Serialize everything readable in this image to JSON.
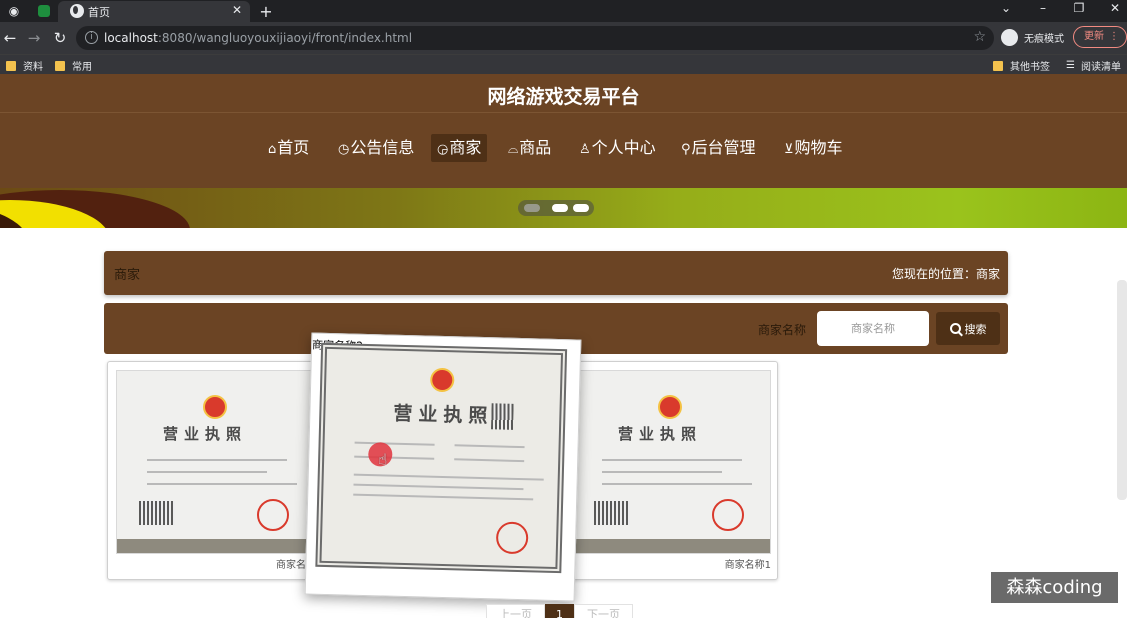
{
  "browser": {
    "tab_title": "首页",
    "url_host": "localhost",
    "url_path": ":8080/wangluoyouxijiaoyi/front/index.html",
    "incognito_label": "无痕模式",
    "update_label": "更新",
    "bookmarks": [
      "资料",
      "常用"
    ],
    "bookmarks_right": [
      "其他书签",
      "阅读清单"
    ]
  },
  "site": {
    "title": "网络游戏交易平台",
    "nav": [
      {
        "icon": "⌂",
        "label": "首页"
      },
      {
        "icon": "◷",
        "label": "公告信息"
      },
      {
        "icon": "◶",
        "label": "商家"
      },
      {
        "icon": "⌓",
        "label": "商品"
      },
      {
        "icon": "♙",
        "label": "个人中心"
      },
      {
        "icon": "⚲",
        "label": "后台管理"
      },
      {
        "icon": "⊻",
        "label": "购物车"
      }
    ],
    "active_nav": "商家"
  },
  "breadcrumb": {
    "section": "商家",
    "location_prefix": "您现在的位置：",
    "location": "商家"
  },
  "search": {
    "label": "商家名称",
    "placeholder": "商家名称",
    "button": "搜索"
  },
  "merchants": [
    {
      "name": "商家名称",
      "image_title": "营业执照"
    },
    {
      "name": "商家名称2",
      "image_title": "营业执照"
    },
    {
      "name": "商家名称1",
      "image_title": "营业执照"
    }
  ],
  "pager": {
    "prev": "上一页",
    "current": "1",
    "next": "下一页"
  },
  "watermark": "森森coding"
}
